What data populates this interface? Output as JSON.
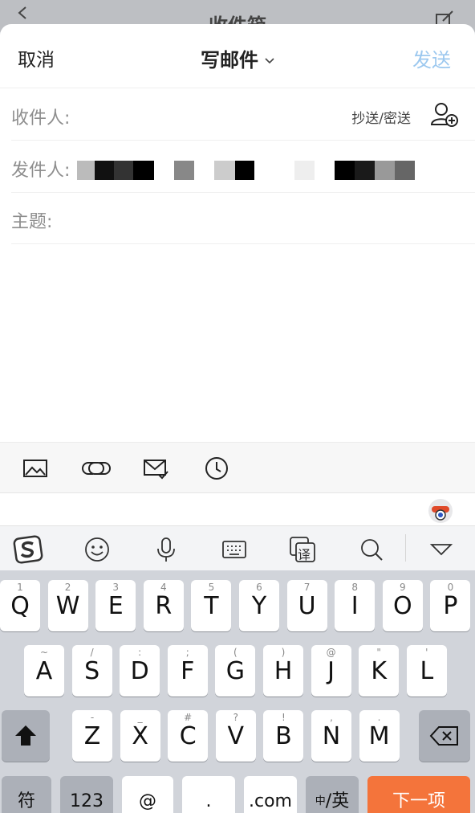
{
  "underlying": {
    "title": "收件箱"
  },
  "compose": {
    "cancel_label": "取消",
    "title": "写邮件",
    "send_label": "发送",
    "to_label": "收件人:",
    "cc_bcc_label": "抄送/密送",
    "from_label": "发件人:",
    "subject_label": "主题:"
  },
  "toolbar": {
    "icons": [
      "image-icon",
      "attachment-link-icon",
      "mail-check-icon",
      "clock-icon"
    ]
  },
  "ime_bar": {
    "icons": [
      "sogou-logo-icon",
      "emoji-icon",
      "microphone-icon",
      "keyboard-icon",
      "translate-icon",
      "search-icon",
      "collapse-icon"
    ],
    "translate_char": "译"
  },
  "keyboard": {
    "row1": [
      {
        "k": "Q",
        "s": "1"
      },
      {
        "k": "W",
        "s": "2"
      },
      {
        "k": "E",
        "s": "3"
      },
      {
        "k": "R",
        "s": "4"
      },
      {
        "k": "T",
        "s": "5"
      },
      {
        "k": "Y",
        "s": "6"
      },
      {
        "k": "U",
        "s": "7"
      },
      {
        "k": "I",
        "s": "8"
      },
      {
        "k": "O",
        "s": "9"
      },
      {
        "k": "P",
        "s": "0"
      }
    ],
    "row2": [
      {
        "k": "A",
        "s": "~"
      },
      {
        "k": "S",
        "s": "/"
      },
      {
        "k": "D",
        "s": ":"
      },
      {
        "k": "F",
        "s": ";"
      },
      {
        "k": "G",
        "s": "("
      },
      {
        "k": "H",
        "s": ")"
      },
      {
        "k": "J",
        "s": "@"
      },
      {
        "k": "K",
        "s": "\""
      },
      {
        "k": "L",
        "s": "'"
      }
    ],
    "row3": [
      {
        "k": "Z",
        "s": "-"
      },
      {
        "k": "X",
        "s": "_"
      },
      {
        "k": "C",
        "s": "#"
      },
      {
        "k": "V",
        "s": "?"
      },
      {
        "k": "B",
        "s": "!"
      },
      {
        "k": "N",
        "s": ","
      },
      {
        "k": "M",
        "s": "."
      }
    ],
    "bottom": {
      "symbols": "符",
      "numbers": "123",
      "at": "@",
      "dot": ".",
      "dotcom": ".com",
      "lang_small": "中",
      "lang_main": "/英",
      "next": "下一项"
    }
  },
  "colors": {
    "accent_send": "#9cc8ef",
    "next_key": "#f4743b"
  }
}
